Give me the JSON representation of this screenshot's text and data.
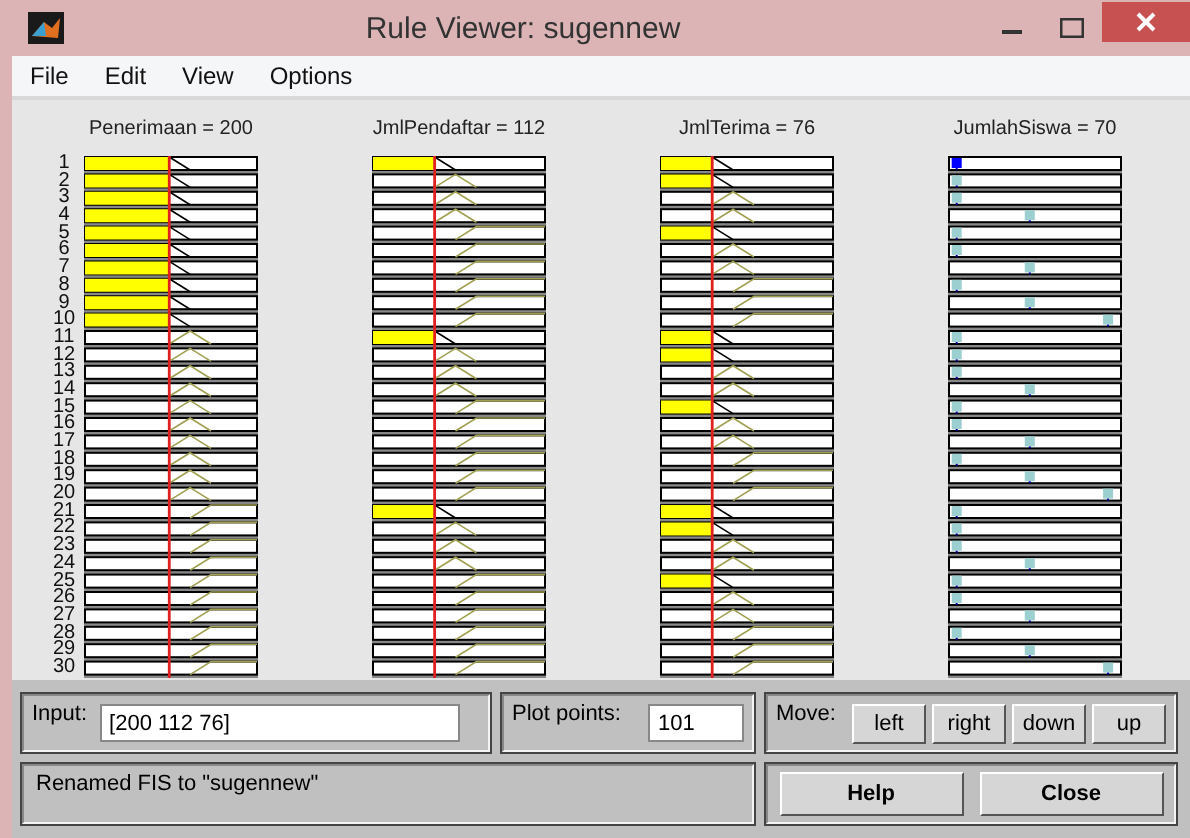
{
  "window": {
    "title": "Rule Viewer: sugennew"
  },
  "menu": [
    "File",
    "Edit",
    "View",
    "Options"
  ],
  "columns": [
    {
      "label": "Penerimaan = 200",
      "kind": "input"
    },
    {
      "label": "JmlPendaftar = 112",
      "kind": "input"
    },
    {
      "label": "JmlTerima = 76",
      "kind": "input"
    },
    {
      "label": "JumlahSiswa = 70",
      "kind": "output"
    }
  ],
  "rules": [
    {
      "number": "1",
      "inputs": [
        {
          "kind": "low"
        },
        {
          "kind": "low"
        },
        {
          "kind": "low"
        }
      ],
      "output": {
        "kind": "low",
        "fired": true
      }
    },
    {
      "number": "2",
      "inputs": [
        {
          "kind": "low"
        },
        {
          "kind": "medium"
        },
        {
          "kind": "low"
        }
      ],
      "output": {
        "kind": "low",
        "fired": false
      }
    },
    {
      "number": "3",
      "inputs": [
        {
          "kind": "low"
        },
        {
          "kind": "medium"
        },
        {
          "kind": "medium"
        }
      ],
      "output": {
        "kind": "low",
        "fired": false
      }
    },
    {
      "number": "4",
      "inputs": [
        {
          "kind": "low"
        },
        {
          "kind": "medium"
        },
        {
          "kind": "medium"
        }
      ],
      "output": {
        "kind": "medium",
        "fired": false
      }
    },
    {
      "number": "5",
      "inputs": [
        {
          "kind": "low"
        },
        {
          "kind": "high"
        },
        {
          "kind": "low"
        }
      ],
      "output": {
        "kind": "low",
        "fired": false
      }
    },
    {
      "number": "6",
      "inputs": [
        {
          "kind": "low"
        },
        {
          "kind": "high"
        },
        {
          "kind": "medium"
        }
      ],
      "output": {
        "kind": "low",
        "fired": false
      }
    },
    {
      "number": "7",
      "inputs": [
        {
          "kind": "low"
        },
        {
          "kind": "high"
        },
        {
          "kind": "medium"
        }
      ],
      "output": {
        "kind": "medium",
        "fired": false
      }
    },
    {
      "number": "8",
      "inputs": [
        {
          "kind": "low"
        },
        {
          "kind": "high"
        },
        {
          "kind": "high"
        }
      ],
      "output": {
        "kind": "low",
        "fired": false
      }
    },
    {
      "number": "9",
      "inputs": [
        {
          "kind": "low"
        },
        {
          "kind": "high"
        },
        {
          "kind": "high"
        }
      ],
      "output": {
        "kind": "medium",
        "fired": false
      }
    },
    {
      "number": "10",
      "inputs": [
        {
          "kind": "low"
        },
        {
          "kind": "high"
        },
        {
          "kind": "high"
        }
      ],
      "output": {
        "kind": "high",
        "fired": false
      }
    },
    {
      "number": "11",
      "inputs": [
        {
          "kind": "medium"
        },
        {
          "kind": "low"
        },
        {
          "kind": "low"
        }
      ],
      "output": {
        "kind": "low",
        "fired": false
      }
    },
    {
      "number": "12",
      "inputs": [
        {
          "kind": "medium"
        },
        {
          "kind": "medium"
        },
        {
          "kind": "low"
        }
      ],
      "output": {
        "kind": "low",
        "fired": false
      }
    },
    {
      "number": "13",
      "inputs": [
        {
          "kind": "medium"
        },
        {
          "kind": "medium"
        },
        {
          "kind": "medium"
        }
      ],
      "output": {
        "kind": "low",
        "fired": false
      }
    },
    {
      "number": "14",
      "inputs": [
        {
          "kind": "medium"
        },
        {
          "kind": "medium"
        },
        {
          "kind": "medium"
        }
      ],
      "output": {
        "kind": "medium",
        "fired": false
      }
    },
    {
      "number": "15",
      "inputs": [
        {
          "kind": "medium"
        },
        {
          "kind": "high"
        },
        {
          "kind": "low"
        }
      ],
      "output": {
        "kind": "low",
        "fired": false
      }
    },
    {
      "number": "16",
      "inputs": [
        {
          "kind": "medium"
        },
        {
          "kind": "high"
        },
        {
          "kind": "medium"
        }
      ],
      "output": {
        "kind": "low",
        "fired": false
      }
    },
    {
      "number": "17",
      "inputs": [
        {
          "kind": "medium"
        },
        {
          "kind": "high"
        },
        {
          "kind": "medium"
        }
      ],
      "output": {
        "kind": "medium",
        "fired": false
      }
    },
    {
      "number": "18",
      "inputs": [
        {
          "kind": "medium"
        },
        {
          "kind": "high"
        },
        {
          "kind": "high"
        }
      ],
      "output": {
        "kind": "low",
        "fired": false
      }
    },
    {
      "number": "19",
      "inputs": [
        {
          "kind": "medium"
        },
        {
          "kind": "high"
        },
        {
          "kind": "high"
        }
      ],
      "output": {
        "kind": "medium",
        "fired": false
      }
    },
    {
      "number": "20",
      "inputs": [
        {
          "kind": "medium"
        },
        {
          "kind": "high"
        },
        {
          "kind": "high"
        }
      ],
      "output": {
        "kind": "high",
        "fired": false
      }
    },
    {
      "number": "21",
      "inputs": [
        {
          "kind": "high"
        },
        {
          "kind": "low"
        },
        {
          "kind": "low"
        }
      ],
      "output": {
        "kind": "low",
        "fired": false
      }
    },
    {
      "number": "22",
      "inputs": [
        {
          "kind": "high"
        },
        {
          "kind": "medium"
        },
        {
          "kind": "low"
        }
      ],
      "output": {
        "kind": "low",
        "fired": false
      }
    },
    {
      "number": "23",
      "inputs": [
        {
          "kind": "high"
        },
        {
          "kind": "medium"
        },
        {
          "kind": "medium"
        }
      ],
      "output": {
        "kind": "low",
        "fired": false
      }
    },
    {
      "number": "24",
      "inputs": [
        {
          "kind": "high"
        },
        {
          "kind": "medium"
        },
        {
          "kind": "medium"
        }
      ],
      "output": {
        "kind": "medium",
        "fired": false
      }
    },
    {
      "number": "25",
      "inputs": [
        {
          "kind": "high"
        },
        {
          "kind": "high"
        },
        {
          "kind": "low"
        }
      ],
      "output": {
        "kind": "low",
        "fired": false
      }
    },
    {
      "number": "26",
      "inputs": [
        {
          "kind": "high"
        },
        {
          "kind": "high"
        },
        {
          "kind": "medium"
        }
      ],
      "output": {
        "kind": "low",
        "fired": false
      }
    },
    {
      "number": "27",
      "inputs": [
        {
          "kind": "high"
        },
        {
          "kind": "high"
        },
        {
          "kind": "medium"
        }
      ],
      "output": {
        "kind": "medium",
        "fired": false
      }
    },
    {
      "number": "28",
      "inputs": [
        {
          "kind": "high"
        },
        {
          "kind": "high"
        },
        {
          "kind": "high"
        }
      ],
      "output": {
        "kind": "low",
        "fired": false
      }
    },
    {
      "number": "29",
      "inputs": [
        {
          "kind": "high"
        },
        {
          "kind": "high"
        },
        {
          "kind": "high"
        }
      ],
      "output": {
        "kind": "medium",
        "fired": false
      }
    },
    {
      "number": "30",
      "inputs": [
        {
          "kind": "high"
        },
        {
          "kind": "high"
        },
        {
          "kind": "high"
        }
      ],
      "output": {
        "kind": "high",
        "fired": false
      }
    }
  ],
  "input": {
    "label": "Input:",
    "value": "[200 112 76]"
  },
  "plot_points": {
    "label": "Plot points:",
    "value": "101"
  },
  "move": {
    "label": "Move:",
    "buttons": [
      "left",
      "right",
      "down",
      "up"
    ]
  },
  "status": "Renamed FIS to \"sugennew\"",
  "buttons": [
    "Help",
    "Close"
  ]
}
